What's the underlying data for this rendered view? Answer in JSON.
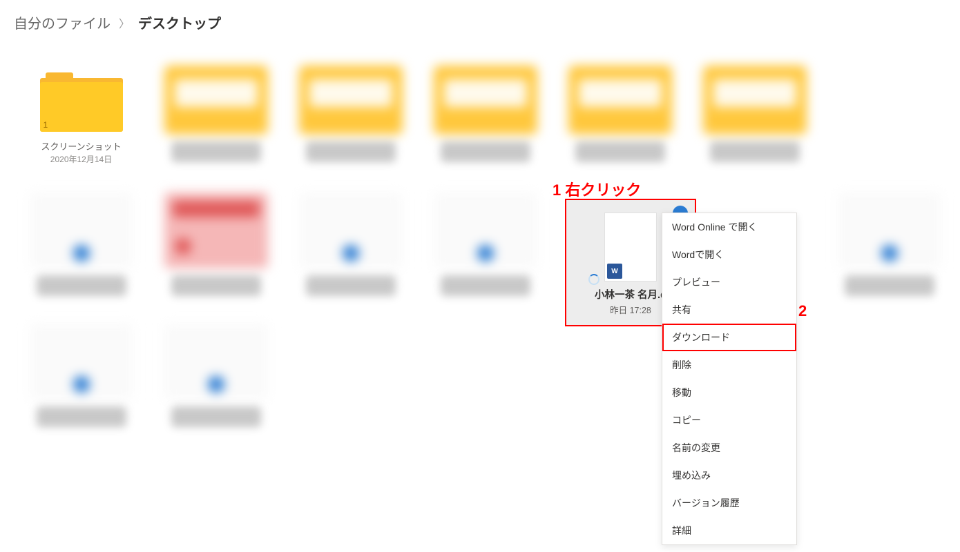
{
  "breadcrumb": {
    "root": "自分のファイル",
    "current": "デスクトップ"
  },
  "folders": {
    "first": {
      "name": "スクリーンショット",
      "date": "2020年12月14日",
      "badge": "1"
    }
  },
  "selected_file": {
    "name": "小林一茶 名月.d",
    "date": "昨日 17:28",
    "icon_label": "W"
  },
  "annotations": {
    "a1": "1 右クリック",
    "a2": "2"
  },
  "context_menu": {
    "items": [
      "Word Online で開く",
      "Wordで開く",
      "プレビュー",
      "共有",
      "ダウンロード",
      "削除",
      "移動",
      "コピー",
      "名前の変更",
      "埋め込み",
      "バージョン履歴",
      "詳細"
    ],
    "highlighted_index": 4
  },
  "colors": {
    "annotation": "#ff0000",
    "accent": "#2b7cd3",
    "folder": "#ffca27"
  }
}
